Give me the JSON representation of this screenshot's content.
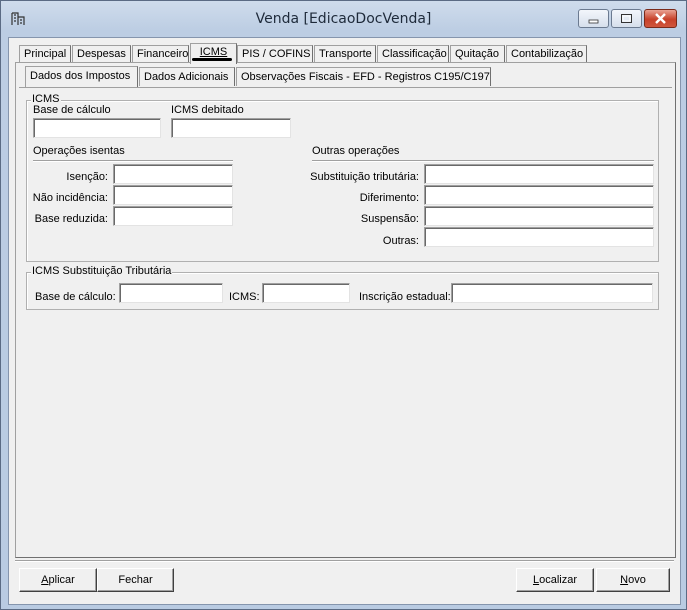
{
  "window": {
    "title": "Venda [EdicaoDocVenda]"
  },
  "tabs": [
    "Principal",
    "Despesas",
    "Financeiro",
    "ICMS",
    "PIS / COFINS",
    "Transporte",
    "Classificação",
    "Quitação",
    "Contabilização"
  ],
  "active_tab": "ICMS",
  "subtabs": [
    "Dados dos Impostos",
    "Dados Adicionais",
    "Observações Fiscais - EFD - Registros C195/C197"
  ],
  "active_subtab": "Dados dos Impostos",
  "icms": {
    "legend": "ICMS",
    "base_calculo_label": "Base de cálculo",
    "base_calculo_value": "",
    "icms_debitado_label": "ICMS debitado",
    "icms_debitado_value": "",
    "operacoes_isentas": {
      "title": "Operações isentas",
      "isencao_label": "Isenção:",
      "nao_incidencia_label": "Não incidência:",
      "base_reduzida_label": "Base reduzida:"
    },
    "outras_operacoes": {
      "title": "Outras operações",
      "substituicao_label": "Substituição tributária:",
      "diferimento_label": "Diferimento:",
      "suspensao_label": "Suspensão:",
      "outras_label": "Outras:"
    }
  },
  "icms_st": {
    "legend": "ICMS Substituição Tributária",
    "base_calculo_label": "Base de cálculo:",
    "icms_label": "ICMS:",
    "inscricao_label": "Inscrição estadual:"
  },
  "buttons": {
    "aplicar": {
      "accel": "A",
      "rest": "plicar"
    },
    "fechar": "Fechar",
    "localizar": {
      "accel": "L",
      "rest": "ocalizar"
    },
    "novo": {
      "accel": "N",
      "rest": "ovo"
    }
  }
}
